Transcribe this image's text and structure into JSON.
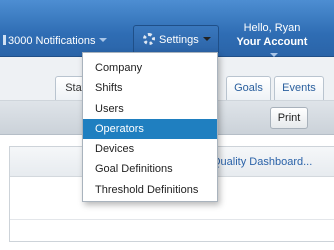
{
  "header": {
    "notifications_label": "3000 Notifications",
    "settings_label": "Settings",
    "greeting": "Hello, Ryan",
    "account_label": "Your Account"
  },
  "settings_menu": {
    "items": [
      {
        "label": "Company"
      },
      {
        "label": "Shifts"
      },
      {
        "label": "Users"
      },
      {
        "label": "Operators"
      },
      {
        "label": "Devices"
      },
      {
        "label": "Goal Definitions"
      },
      {
        "label": "Threshold Definitions"
      }
    ],
    "highlighted": "Operators"
  },
  "tabs": [
    {
      "label": "Stat"
    },
    {
      "label": "Goals"
    },
    {
      "label": "Events"
    }
  ],
  "toolbar": {
    "print_label": "Print"
  },
  "panel": {
    "link_text": "Quality Dashboard..."
  },
  "colors": {
    "nav_bar": "#2f6db4",
    "menu_highlight": "#1f7fc0",
    "link": "#2a62a8"
  }
}
